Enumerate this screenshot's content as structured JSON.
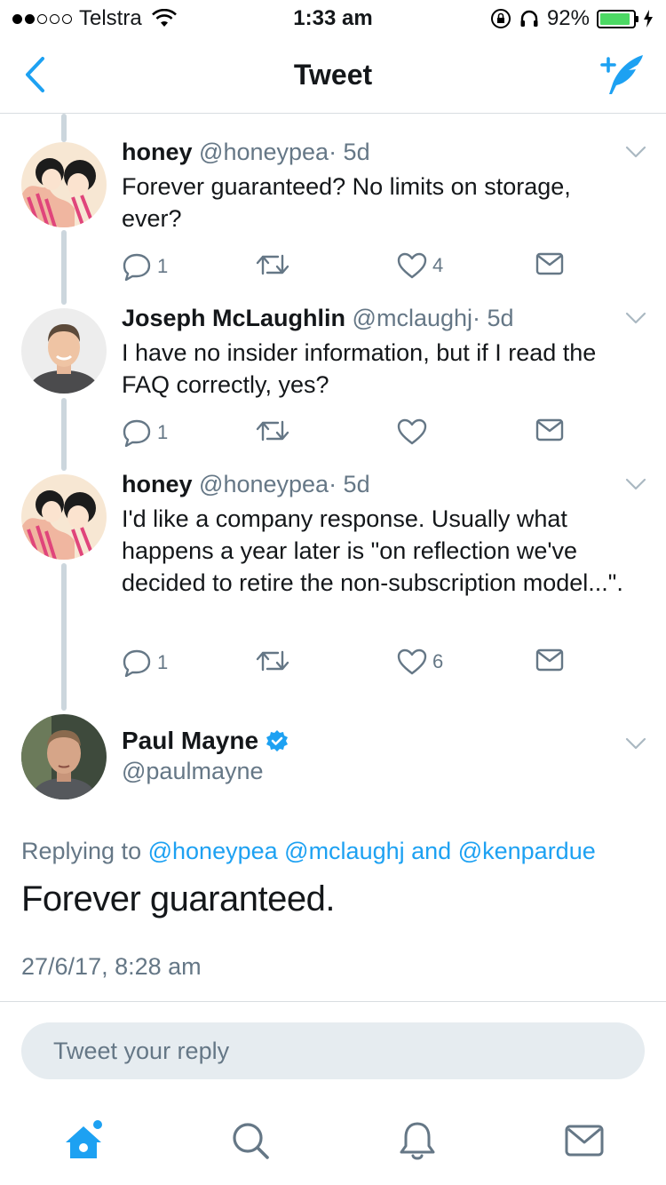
{
  "status_bar": {
    "carrier": "Telstra",
    "time": "1:33 am",
    "battery": "92%",
    "battery_level": 0.92
  },
  "nav": {
    "title": "Tweet"
  },
  "thread": [
    {
      "name": "honey",
      "handle": "@honeypea",
      "age": "· 5d",
      "text": "Forever guaranteed? No limits on storage, ever?",
      "replies": "1",
      "retweets": "",
      "likes": "4"
    },
    {
      "name": "Joseph McLaughlin",
      "handle": "@mclaughj",
      "age": "· 5d",
      "text": "I have no insider information, but if I read the FAQ correctly, yes?",
      "replies": "1",
      "retweets": "",
      "likes": ""
    },
    {
      "name": "honey",
      "handle": "@honeypea",
      "age": "· 5d",
      "text": "I'd like a company response. Usually what happens a year later is \"on reflection we've decided to retire the non-subscription model...\".",
      "replies": "1",
      "retweets": "",
      "likes": "6"
    }
  ],
  "main_tweet": {
    "name": "Paul Mayne",
    "handle": "@paulmayne",
    "replying_prefix": "Replying to",
    "mention_1": "@honeypea",
    "mention_2": "@mclaughj",
    "mention_and": "and",
    "mention_3": "@kenpardue",
    "text": "Forever guaranteed.",
    "timestamp": "27/6/17, 8:28 am"
  },
  "reply": {
    "placeholder": "Tweet your reply"
  },
  "colors": {
    "accent": "#1da1f2",
    "secondary_text": "#657786",
    "thread_line": "#ccd6dd"
  },
  "icons": {
    "back": "chevron-left-icon",
    "compose": "compose-tweet-icon",
    "reply": "reply-icon",
    "retweet": "retweet-icon",
    "like": "heart-icon",
    "dm": "envelope-icon",
    "more": "chevron-down-icon",
    "verified": "verified-badge-icon",
    "tab_home": "home-icon",
    "tab_search": "search-icon",
    "tab_notifications": "bell-icon",
    "tab_messages": "envelope-icon"
  }
}
